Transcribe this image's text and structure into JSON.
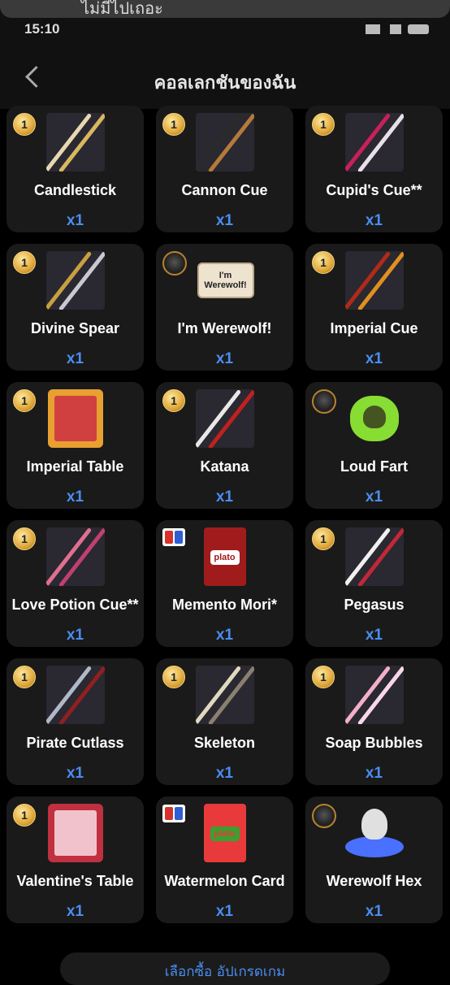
{
  "notification": {
    "text": "ไม่มีไปเถอะ"
  },
  "status": {
    "time": "15:10"
  },
  "header": {
    "title": "คอลเลกชันของฉัน",
    "back_icon": "chevron-left-icon"
  },
  "items": [
    {
      "name": "Candlestick",
      "qty": "x1",
      "badge": "1",
      "badge_type": "coin",
      "icon": "cue-icon",
      "colors": [
        "#e8d7b0",
        "#d8b860"
      ]
    },
    {
      "name": "Cannon Cue",
      "qty": "x1",
      "badge": "1",
      "badge_type": "coin",
      "icon": "cue-icon",
      "colors": [
        "#2b2b2b",
        "#b57a3a"
      ]
    },
    {
      "name": "Cupid's Cue**",
      "qty": "x1",
      "badge": "1",
      "badge_type": "coin",
      "icon": "cue-icon",
      "colors": [
        "#c9205a",
        "#e8e0e8"
      ]
    },
    {
      "name": "Divine Spear",
      "qty": "x1",
      "badge": "1",
      "badge_type": "coin",
      "icon": "spear-icon",
      "colors": [
        "#c8a040",
        "#c8c8d0"
      ]
    },
    {
      "name": "I'm Werewolf!",
      "qty": "x1",
      "badge": "",
      "badge_type": "wolf",
      "icon": "sign-icon",
      "sign_text": "I'm Werewolf!",
      "colors": [
        "#eee3cf",
        "#222"
      ]
    },
    {
      "name": "Imperial Cue",
      "qty": "x1",
      "badge": "1",
      "badge_type": "coin",
      "icon": "cue-icon",
      "colors": [
        "#b02a1a",
        "#e09020"
      ]
    },
    {
      "name": "Imperial Table",
      "qty": "x1",
      "badge": "1",
      "badge_type": "coin",
      "icon": "table-icon",
      "colors": [
        "#d04040",
        "#e8a030"
      ]
    },
    {
      "name": "Katana",
      "qty": "x1",
      "badge": "1",
      "badge_type": "coin",
      "icon": "katana-icon",
      "colors": [
        "#e8e8e8",
        "#c02020"
      ]
    },
    {
      "name": "Loud Fart",
      "qty": "x1",
      "badge": "",
      "badge_type": "wolf",
      "icon": "skull-cloud-icon",
      "colors": [
        "#88dd33",
        "#445522"
      ]
    },
    {
      "name": "Love Potion Cue**",
      "qty": "x1",
      "badge": "1",
      "badge_type": "coin",
      "icon": "cue-icon",
      "colors": [
        "#e07090",
        "#c04070"
      ]
    },
    {
      "name": "Memento Mori*",
      "qty": "x1",
      "badge": "",
      "badge_type": "plato",
      "icon": "card-icon",
      "card_text": "plato",
      "colors": [
        "#a01c1c",
        "#ffffff"
      ]
    },
    {
      "name": "Pegasus",
      "qty": "x1",
      "badge": "1",
      "badge_type": "coin",
      "icon": "cue-icon",
      "colors": [
        "#f0f0f0",
        "#c02838"
      ]
    },
    {
      "name": "Pirate Cutlass",
      "qty": "x1",
      "badge": "1",
      "badge_type": "coin",
      "icon": "cutlass-icon",
      "colors": [
        "#b0b8c8",
        "#902020"
      ]
    },
    {
      "name": "Skeleton",
      "qty": "x1",
      "badge": "1",
      "badge_type": "coin",
      "icon": "cue-icon",
      "colors": [
        "#e0d8c0",
        "#8a8070"
      ]
    },
    {
      "name": "Soap Bubbles",
      "qty": "x1",
      "badge": "1",
      "badge_type": "coin",
      "icon": "cue-icon",
      "colors": [
        "#f4b0c8",
        "#f8d8e8"
      ]
    },
    {
      "name": "Valentine's Table",
      "qty": "x1",
      "badge": "1",
      "badge_type": "coin",
      "icon": "table-icon",
      "colors": [
        "#f2c2cc",
        "#c03040"
      ]
    },
    {
      "name": "Watermelon Card",
      "qty": "x1",
      "badge": "",
      "badge_type": "plato",
      "icon": "card-icon",
      "card_text": "plato",
      "colors": [
        "#e83a3a",
        "#3aa030"
      ]
    },
    {
      "name": "Werewolf Hex",
      "qty": "x1",
      "badge": "",
      "badge_type": "wolf",
      "icon": "skull-portal-icon",
      "colors": [
        "#4a70ff",
        "#e0e0e0"
      ]
    }
  ],
  "bottom_bar": {
    "label": "เลือกซื้อ อัปเกรดเกม"
  },
  "colors": {
    "background": "#000000",
    "card": "#1a1a1a",
    "qty": "#4a8df0"
  }
}
